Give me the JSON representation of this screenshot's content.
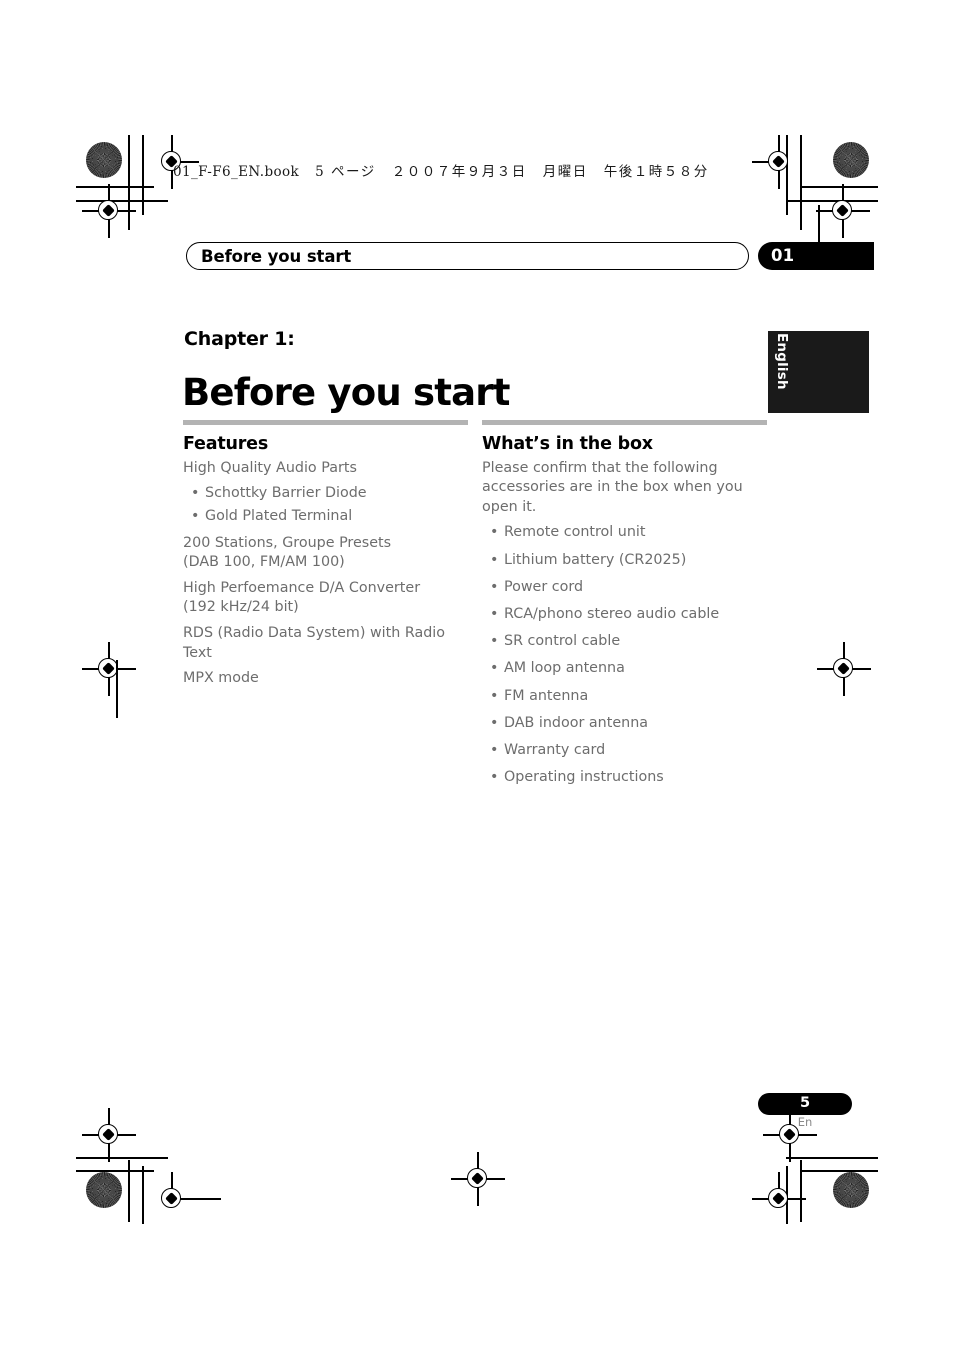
{
  "file_header": {
    "filename": "01_F-F6_EN.book",
    "page_marker": "5 ページ",
    "date": "２００７年９月３日",
    "weekday": "月曜日",
    "time": "午後１時５８分",
    "full": "01_F-F6_EN.book  5 ページ  ２００７年９月３日  月曜日  午後１時５８分"
  },
  "running_head": {
    "title": "Before you start",
    "chapter_number": "01"
  },
  "chapter": {
    "label": "Chapter 1:",
    "title": "Before you start"
  },
  "language_tab": {
    "label": "English"
  },
  "columns": {
    "left": {
      "heading": "Features",
      "intro": "High Quality Audio Parts",
      "bullets": [
        "Schottky Barrier Diode",
        "Gold Plated Terminal"
      ],
      "paragraphs": [
        "200 Stations, Groupe Presets\n(DAB 100, FM/AM 100)",
        "High Perfoemance D/A Converter\n(192 kHz/24 bit)",
        "RDS (Radio Data System) with Radio Text",
        "MPX mode"
      ],
      "para_1_line_1": "200 Stations, Groupe Presets",
      "para_1_line_2": "(DAB 100, FM/AM 100)",
      "para_2_line_1": "High Perfoemance D/A Converter",
      "para_2_line_2": "(192 kHz/24 bit)",
      "para_3": "RDS (Radio Data System) with Radio Text",
      "para_4": "MPX mode"
    },
    "right": {
      "heading": "What’s in the box",
      "intro": "Please confirm that the following accessories are in the box when you open it.",
      "bullets": [
        "Remote control unit",
        "Lithium battery (CR2025)",
        "Power cord",
        "RCA/phono stereo audio cable",
        "SR control cable",
        "AM loop antenna",
        "FM antenna",
        "DAB indoor antenna",
        "Warranty card",
        "Operating instructions"
      ]
    }
  },
  "footer": {
    "page_number": "5",
    "language_code": "En"
  },
  "bullet_glyph": "•",
  "colors": {
    "body_text": "#6d6d6d",
    "heading_text": "#000000",
    "rule": "#b3b3b3",
    "badge_bg": "#000000",
    "tab_bg": "#1a1a1a",
    "page_bg": "#ffffff"
  }
}
